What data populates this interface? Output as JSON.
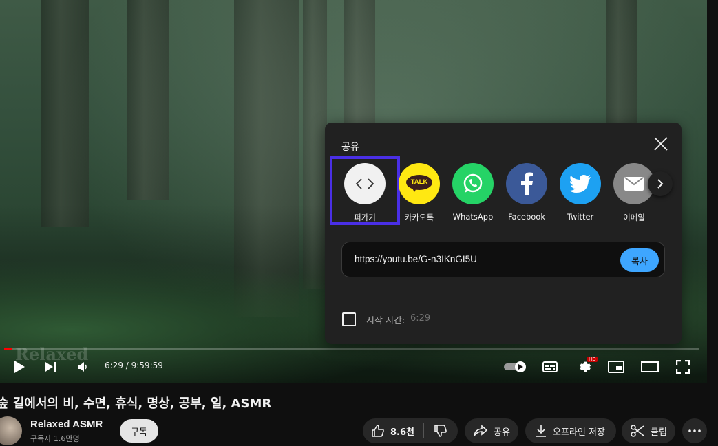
{
  "player": {
    "watermark": "Relaxed",
    "time_current": "6:29",
    "time_total": "9:59:59",
    "time_display": "6:29 / 9:59:59",
    "progress_fraction": 0.0109,
    "quality_badge": "HD"
  },
  "share_dialog": {
    "title": "공유",
    "items": [
      {
        "label": "퍼가기",
        "icon": "embed-icon",
        "color": "#f1f1f1"
      },
      {
        "label": "카카오톡",
        "icon": "kakaotalk-icon",
        "color": "#ffe812",
        "badge": "TALK"
      },
      {
        "label": "WhatsApp",
        "icon": "whatsapp-icon",
        "color": "#25d366"
      },
      {
        "label": "Facebook",
        "icon": "facebook-icon",
        "color": "#3b5998"
      },
      {
        "label": "Twitter",
        "icon": "twitter-icon",
        "color": "#1da1f2"
      },
      {
        "label": "이메일",
        "icon": "email-icon",
        "color": "#888888"
      }
    ],
    "url": "https://youtu.be/G-n3IKnGI5U",
    "copy_label": "복사",
    "start_time_label": "시작 시간:",
    "start_time_value": "6:29",
    "start_time_checked": false
  },
  "video": {
    "title": "숲 길에서의 비, 수면, 휴식, 명상, 공부, 일, ASMR",
    "channel": "Relaxed ASMR",
    "subscribers": "구독자 1.6만명",
    "subscribe_label": "구독",
    "like_count": "8.6천",
    "share_label": "공유",
    "download_label": "오프라인 저장",
    "clip_label": "클립"
  },
  "colors": {
    "accent_blue": "#3ea6ff",
    "highlight": "#4a2fe6",
    "background": "#0f0f0f",
    "dialog": "#212121"
  }
}
